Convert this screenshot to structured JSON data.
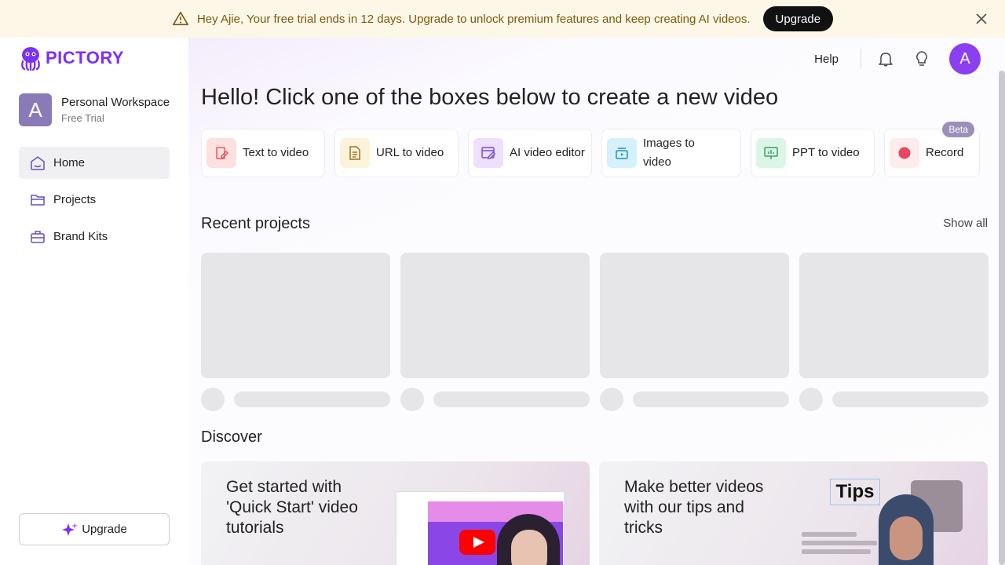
{
  "banner": {
    "message": "Hey Ajie, Your free trial ends in 12 days. Upgrade to unlock premium features and keep creating AI videos.",
    "upgrade_label": "Upgrade"
  },
  "brand": {
    "name": "PICTORY"
  },
  "workspace": {
    "avatar_letter": "A",
    "name": "Personal Workspace",
    "plan": "Free Trial"
  },
  "sidebar": {
    "items": [
      {
        "label": "Home",
        "icon": "home-icon"
      },
      {
        "label": "Projects",
        "icon": "folder-icon"
      },
      {
        "label": "Brand Kits",
        "icon": "briefcase-icon"
      }
    ],
    "upgrade_label": "Upgrade"
  },
  "topbar": {
    "help_label": "Help",
    "user_initial": "A"
  },
  "main": {
    "heading": "Hello! Click one of the boxes below to create a new video",
    "create_cards": [
      {
        "label": "Text to video",
        "icon": "text-to-video-icon",
        "color": "#fde0e0"
      },
      {
        "label": "URL to video",
        "icon": "url-doc-icon",
        "color": "#fdf3dc"
      },
      {
        "label": "AI video editor",
        "icon": "video-edit-icon",
        "color": "#ece0fb"
      },
      {
        "label": "Images to video",
        "icon": "images-icon",
        "color": "#d5f1fb"
      },
      {
        "label": "PPT to video",
        "icon": "presentation-icon",
        "color": "#dcf5e6"
      },
      {
        "label": "Record",
        "icon": "record-icon",
        "color": "#fdecec",
        "badge": "Beta"
      }
    ],
    "recent_title": "Recent projects",
    "show_all": "Show all",
    "discover_title": "Discover",
    "discover_cards": [
      {
        "title": "Get started with 'Quick Start' video tutorials"
      },
      {
        "title": "Make better videos with our tips and tricks",
        "overlay": "Tips"
      }
    ]
  },
  "colors": {
    "accent": "#7b2ff7",
    "banner_bg": "#fdf7e8",
    "banner_text": "#7a5a0a"
  }
}
